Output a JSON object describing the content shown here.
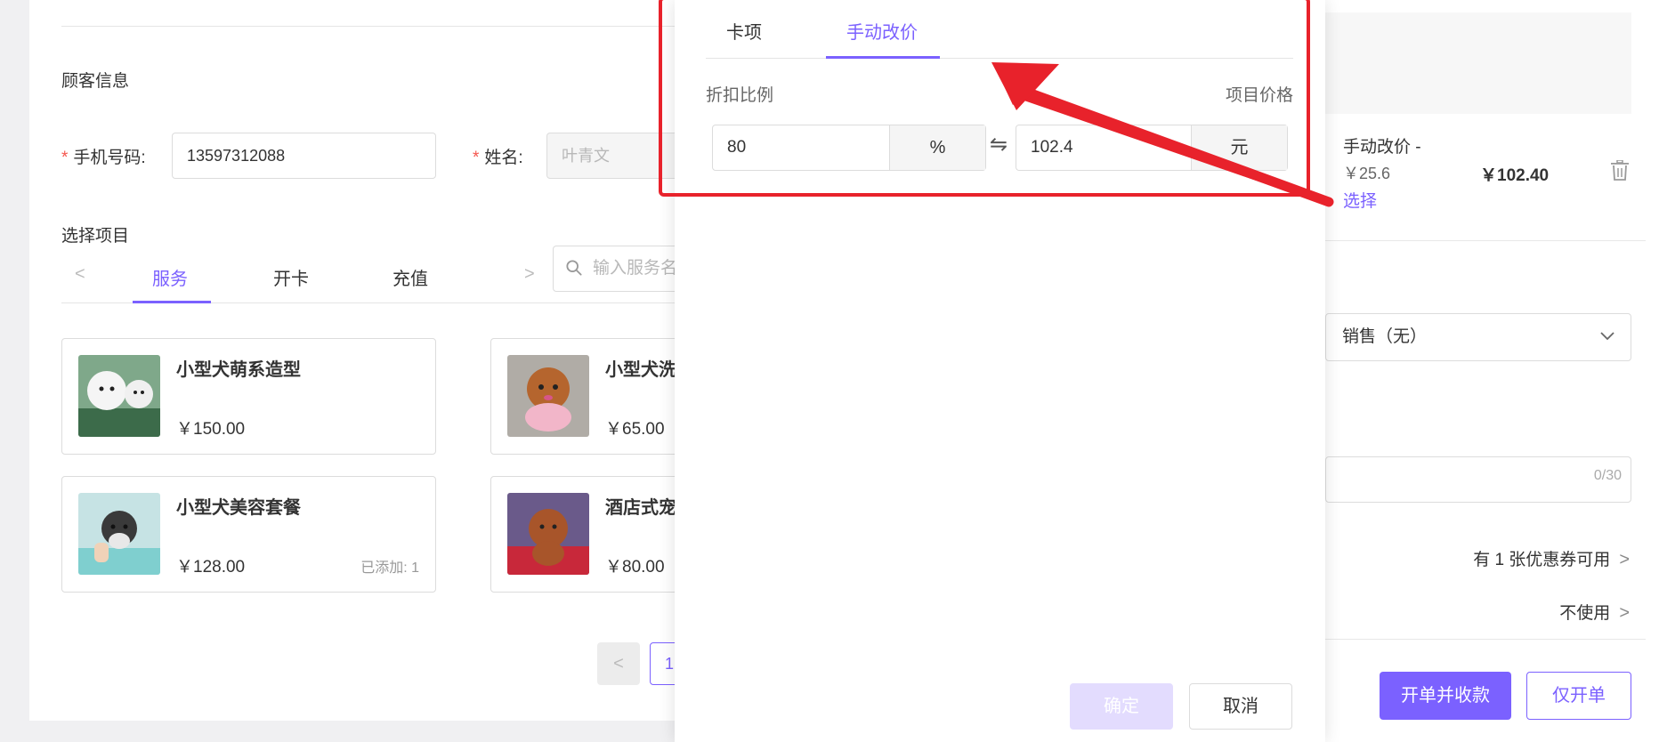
{
  "customer": {
    "section_title": "顾客信息",
    "required_mark": "*",
    "phone_label": "手机号码:",
    "phone_value": "13597312088",
    "name_label": "姓名:",
    "name_value": "叶青文"
  },
  "items": {
    "section_title": "选择项目",
    "tabs": [
      "服务",
      "开卡",
      "充值"
    ],
    "active_tab": "服务",
    "prev_arrow": "<",
    "next_arrow": ">",
    "search_placeholder": "输入服务名称",
    "cards": [
      {
        "name": "小型犬萌系造型",
        "price": "￥150.00",
        "added": ""
      },
      {
        "name": "小型犬洗",
        "price": "￥65.00",
        "added": ""
      },
      {
        "name": "小型犬美容套餐",
        "price": "￥128.00",
        "added": "已添加: 1"
      },
      {
        "name": "酒店式宠",
        "price": "￥80.00",
        "added": ""
      }
    ],
    "pagination": {
      "prev": "<",
      "current_page": "1"
    }
  },
  "modal": {
    "tabs": [
      "卡项",
      "手动改价"
    ],
    "active_tab": "手动改价",
    "discount_label": "折扣比例",
    "price_label": "项目价格",
    "discount_value": "80",
    "discount_unit": "%",
    "swap_symbol": "⇋",
    "price_value": "102.4",
    "price_unit": "元",
    "confirm_label": "确定",
    "cancel_label": "取消"
  },
  "right_panel": {
    "item_title": "手动改价 -",
    "item_sub": "￥25.6",
    "item_link": "选择",
    "item_price": "￥102.40",
    "seller_select": "销售（无）",
    "note_count": "0/30",
    "coupon_text": "有 1 张优惠券可用",
    "coupon_use": "不使用",
    "chev": ">",
    "btn_checkout": "开单并收款",
    "btn_order_only": "仅开单"
  },
  "colors": {
    "accent": "#7b61ff",
    "annotation_red": "#e8222b",
    "required": "#f5564e"
  },
  "icons": {
    "search": "search-icon",
    "trash": "trash-icon",
    "chevron": "chevron-down-icon",
    "annotation_arrow": "red-arrow-icon"
  }
}
